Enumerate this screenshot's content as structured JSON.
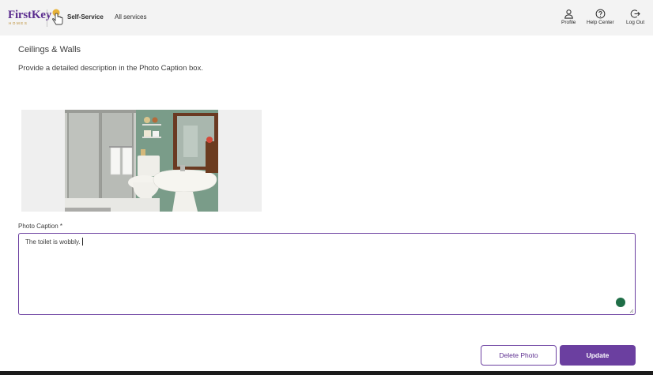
{
  "header": {
    "logo_main": "FirstKey",
    "logo_sub": "HOMES",
    "nav": {
      "self_service": "Self-Service",
      "all_services": "All services"
    },
    "actions": [
      {
        "label": "Profile",
        "icon": "user-icon"
      },
      {
        "label": "Help Center",
        "icon": "question-circle-icon"
      },
      {
        "label": "Log Out",
        "icon": "logout-icon"
      }
    ]
  },
  "main": {
    "heading": "Ceilings & Walls",
    "instruction": "Provide a detailed description in the Photo Caption box.",
    "photo": {
      "subject": "bathroom photo with shower, toilet, sink and mirror"
    },
    "caption": {
      "label": "Photo Caption *",
      "value": "The toilet is wobbly."
    },
    "buttons": {
      "delete": "Delete Photo",
      "update": "Update"
    }
  },
  "colors": {
    "accent": "#6b3fa0",
    "brand": "#5b2d8f",
    "header_bg": "#f3f3f3"
  }
}
